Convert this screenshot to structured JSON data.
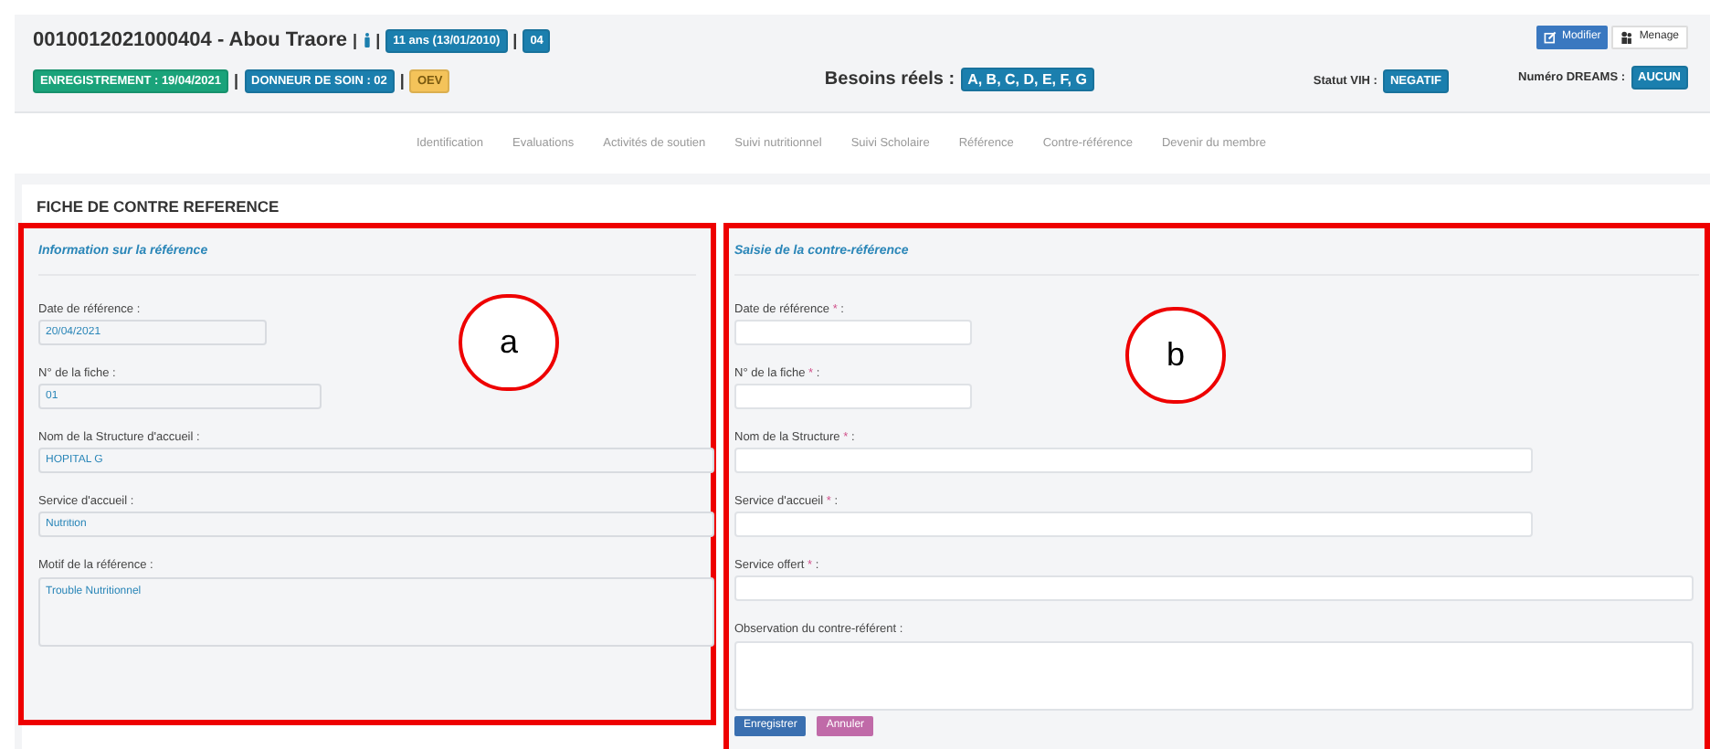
{
  "header": {
    "line1": [
      {
        "kind": "text",
        "text": "0010012021000404 - Abou Traore"
      },
      {
        "kind": "sep",
        "text": "|"
      },
      {
        "kind": "icon"
      },
      {
        "kind": "sep",
        "text": "|"
      },
      {
        "kind": "badge",
        "text": "11 ans (13/01/2010)",
        "color": "#1b7fae"
      },
      {
        "kind": "sep",
        "text": "|"
      },
      {
        "kind": "badge",
        "text": "04",
        "color": "#1b7fae"
      }
    ],
    "line2": [
      {
        "kind": "badge",
        "text": "ENREGISTREMENT : 19/04/2021",
        "color": "#1aa37a"
      },
      {
        "kind": "sep",
        "text": "|"
      },
      {
        "kind": "badge",
        "text": "DONNEUR DE SOIN : 02",
        "color": "#1b7fae"
      },
      {
        "kind": "sep",
        "text": "|"
      },
      {
        "kind": "badge",
        "text": "OEV",
        "color": "#f4c35a"
      }
    ],
    "besoins": {
      "label": "Besoins réels :",
      "value": "A, B, C, D, E, F, G"
    },
    "statut": {
      "label": "Statut VIH :",
      "value": "NEGATIF"
    },
    "dreams": {
      "label": "Numéro DREAMS :",
      "value": "AUCUN"
    },
    "buttons": [
      {
        "kind": "primary",
        "label": "Modifier"
      },
      {
        "kind": "default",
        "label": "Menage"
      }
    ]
  },
  "nav": [
    "Identification",
    "Evaluations",
    "Activités de soutien",
    "Suivi nutritionnel",
    "Suivi Scholaire",
    "Référence",
    "Contre-référence",
    "Devenir du membre"
  ],
  "card": {
    "title": "FICHE DE CONTRE REFERENCE",
    "left": {
      "title": "Information sur la référence",
      "fields": [
        {
          "label": "Date de référence :",
          "value": "20/04/2021",
          "kind": "input"
        },
        {
          "label": "N° de la fiche :",
          "value": "01",
          "kind": "input"
        },
        {
          "label": "Nom de la Structure d'accueil :",
          "value": "HOPITAL G",
          "kind": "input"
        },
        {
          "label": "Service d'accueil :",
          "value": "Nutrition",
          "kind": "input"
        },
        {
          "label": "Motif de la référence :",
          "value": "Trouble Nutritionnel",
          "kind": "textarea"
        }
      ]
    },
    "right": {
      "title": "Saisie de la contre-référence",
      "fields": [
        {
          "label": "Date de référence",
          "mark": "*",
          "suffix": ":",
          "kind": "input"
        },
        {
          "label": "N° de la fiche",
          "mark": "*",
          "suffix": ":",
          "kind": "input"
        },
        {
          "label": "Nom de la Structure",
          "mark": "*",
          "suffix": ":",
          "kind": "input"
        },
        {
          "label": "Service d'accueil",
          "mark": "*",
          "suffix": ":",
          "kind": "input"
        },
        {
          "label": "Service offert",
          "mark": "*",
          "suffix": ":",
          "kind": "input"
        },
        {
          "label": "Observation du contre-référent :",
          "kind": "textarea"
        }
      ],
      "buttons": [
        {
          "kind": "save",
          "label": "Enregistrer"
        },
        {
          "kind": "cancel",
          "label": "Annuler"
        }
      ]
    }
  },
  "annotations": [
    {
      "label": "a"
    },
    {
      "label": "b"
    }
  ]
}
